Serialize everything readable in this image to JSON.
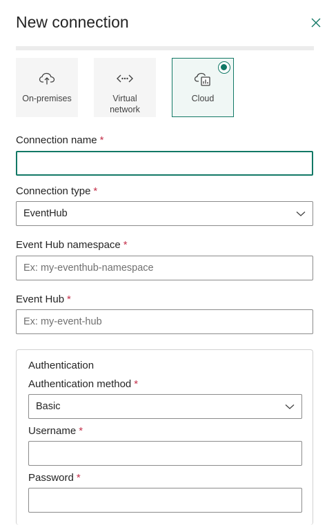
{
  "header": {
    "title": "New connection"
  },
  "tiles": [
    {
      "label": "On-premises",
      "icon": "cloud-upload-icon",
      "selected": false
    },
    {
      "label": "Virtual network",
      "icon": "virtual-network-icon",
      "selected": false
    },
    {
      "label": "Cloud",
      "icon": "cloud-report-icon",
      "selected": true
    }
  ],
  "form": {
    "connection_name": {
      "label": "Connection name",
      "required": "*",
      "value": "",
      "placeholder": ""
    },
    "connection_type": {
      "label": "Connection type",
      "required": "*",
      "value": "EventHub"
    },
    "eventhub_namespace": {
      "label": "Event Hub namespace",
      "required": "*",
      "value": "",
      "placeholder": "Ex: my-eventhub-namespace"
    },
    "eventhub": {
      "label": "Event Hub",
      "required": "*",
      "value": "",
      "placeholder": "Ex: my-event-hub"
    }
  },
  "auth": {
    "title": "Authentication",
    "method": {
      "label": "Authentication method",
      "required": "*",
      "value": "Basic"
    },
    "username": {
      "label": "Username",
      "required": "*",
      "value": "",
      "placeholder": ""
    },
    "password": {
      "label": "Password",
      "required": "*",
      "value": "",
      "placeholder": ""
    }
  },
  "colors": {
    "accent": "#117865",
    "required": "#c4314b",
    "border": "#8a8a8a"
  }
}
